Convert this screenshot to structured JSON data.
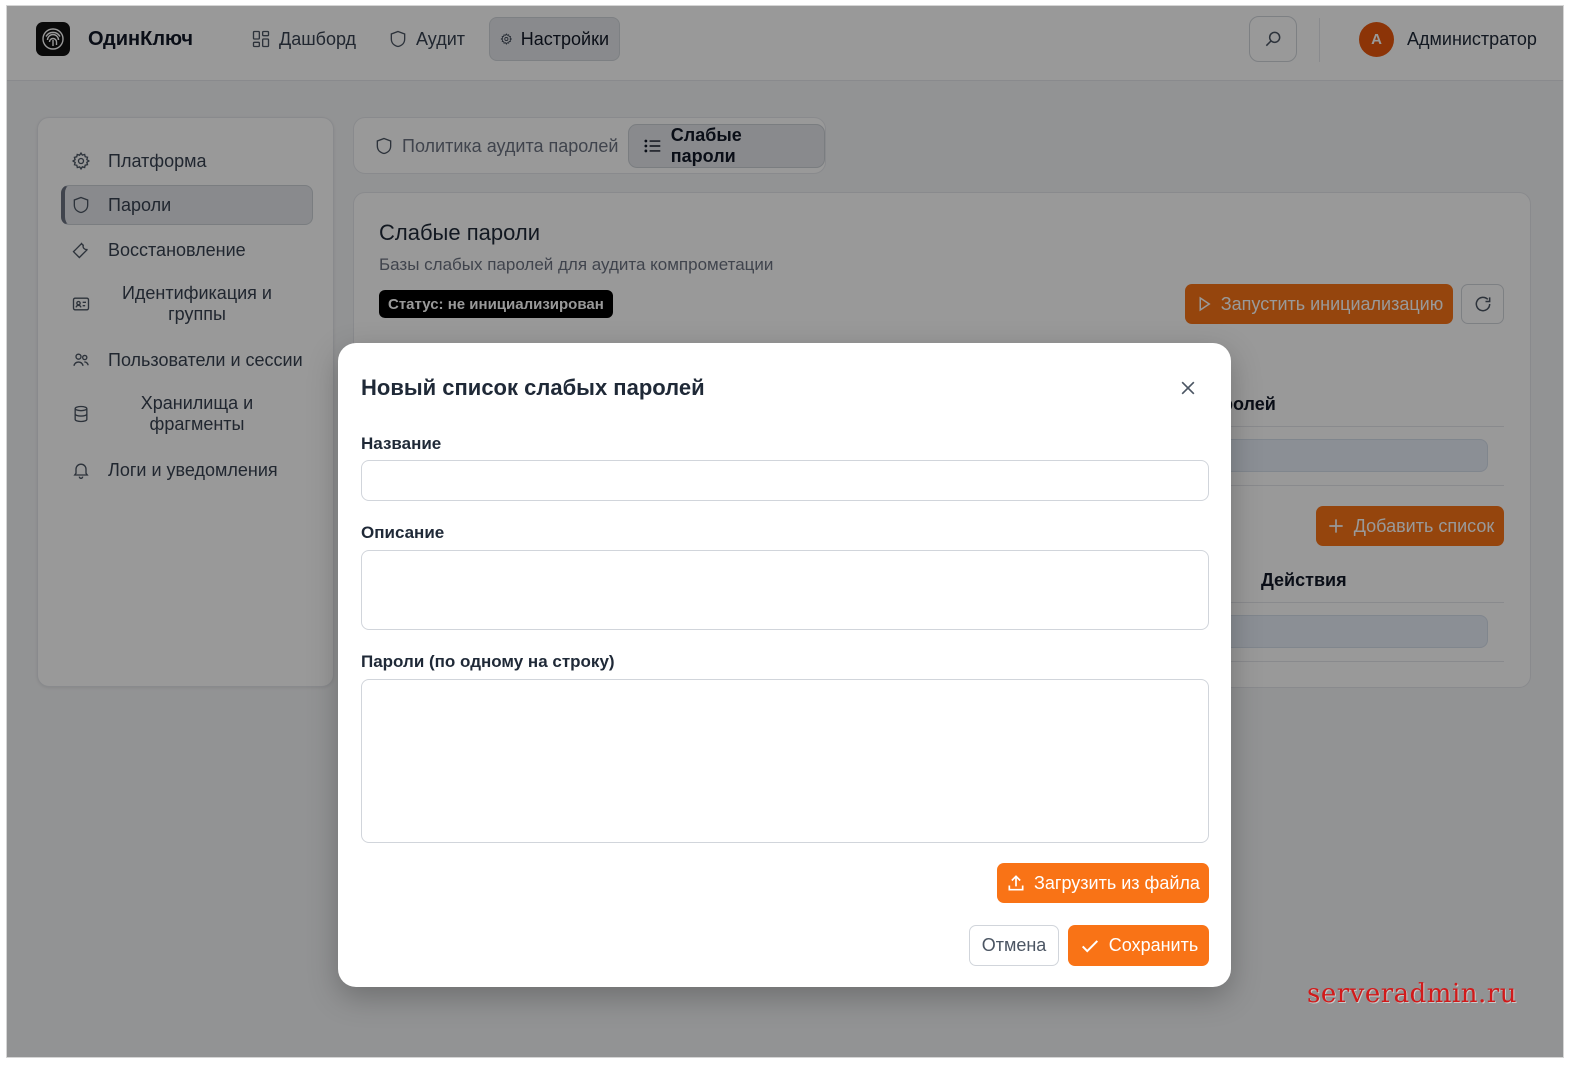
{
  "header": {
    "brand": "ОдинКлюч",
    "nav": [
      {
        "label": "Дашборд",
        "icon": "dashboard-icon"
      },
      {
        "label": "Аудит",
        "icon": "shield-icon"
      },
      {
        "label": "Настройки",
        "icon": "gear-icon",
        "active": true
      }
    ],
    "user_initial": "А",
    "user_name": "Администратор"
  },
  "sidebar": {
    "items": [
      {
        "label": "Платформа",
        "icon": "gear-icon"
      },
      {
        "label": "Пароли",
        "icon": "shield-icon",
        "active": true
      },
      {
        "label": "Восстановление",
        "icon": "wrench-icon"
      },
      {
        "label": "Идентификация и группы",
        "icon": "id-card-icon"
      },
      {
        "label": "Пользователи и сессии",
        "icon": "users-icon"
      },
      {
        "label": "Хранилища и фрагменты",
        "icon": "database-icon"
      },
      {
        "label": "Логи и уведомления",
        "icon": "bell-icon"
      }
    ]
  },
  "tabs": [
    {
      "label": "Политика аудита паролей",
      "icon": "shield-icon"
    },
    {
      "label": "Слабые пароли",
      "icon": "list-icon",
      "active": true
    }
  ],
  "card": {
    "title": "Слабые пароли",
    "subtitle": "Базы слабых паролей для аудита компрометации",
    "status": "Статус: не инициализирован",
    "init_button": "Запустить инициализацию",
    "column_partial": "ролей",
    "add_button": "Добавить список",
    "actions_header": "Действия"
  },
  "modal": {
    "title": "Новый список слабых паролей",
    "name_label": "Название",
    "name_value": "",
    "description_label": "Описание",
    "description_value": "",
    "passwords_label": "Пароли (по одному на строку)",
    "passwords_value": "",
    "upload_button": "Загрузить из файла",
    "cancel_button": "Отмена",
    "save_button": "Сохранить"
  },
  "watermark": "serveradmin.ru",
  "colors": {
    "accent": "#f97316",
    "avatar": "#ea580c",
    "overlay": "rgba(0,0,0,0.4)"
  }
}
